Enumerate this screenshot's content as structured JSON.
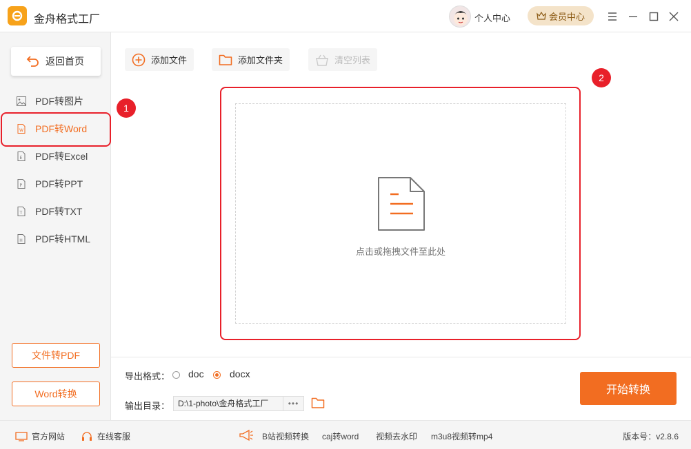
{
  "app": {
    "title": "金舟格式工厂"
  },
  "header": {
    "user_center": "个人中心",
    "vip": "会员中心"
  },
  "sidebar": {
    "back": "返回首页",
    "items": [
      {
        "label": "PDF转图片",
        "icon": "image-file-icon",
        "active": false
      },
      {
        "label": "PDF转Word",
        "icon": "word-file-icon",
        "active": true
      },
      {
        "label": "PDF转Excel",
        "icon": "excel-file-icon",
        "active": false
      },
      {
        "label": "PDF转PPT",
        "icon": "ppt-file-icon",
        "active": false
      },
      {
        "label": "PDF转TXT",
        "icon": "txt-file-icon",
        "active": false
      },
      {
        "label": "PDF转HTML",
        "icon": "html-file-icon",
        "active": false
      }
    ],
    "bottom_buttons": [
      "文件转PDF",
      "Word转换"
    ]
  },
  "toolbar": {
    "add_file": "添加文件",
    "add_folder": "添加文件夹",
    "clear_list": "清空列表"
  },
  "dropzone": {
    "hint": "点击或拖拽文件至此处"
  },
  "annotations": {
    "badge1": "1",
    "badge2": "2"
  },
  "settings": {
    "format_label": "导出格式：",
    "formats": [
      "doc",
      "docx"
    ],
    "selected_format": "docx",
    "output_label": "输出目录：",
    "output_path": "D:\\1-photo\\金舟格式工厂",
    "more": "•••",
    "start": "开始转换"
  },
  "statusbar": {
    "website": "官方网站",
    "service": "在线客服",
    "links": [
      "B站视频转换",
      "caj转word",
      "视频去水印",
      "m3u8视频转mp4"
    ],
    "version": "版本号：v2.8.6"
  },
  "colors": {
    "accent": "#f26d21",
    "annotation": "#e8202a",
    "vip_bg": "#f4e3c9",
    "logo": "#f7a21a"
  }
}
